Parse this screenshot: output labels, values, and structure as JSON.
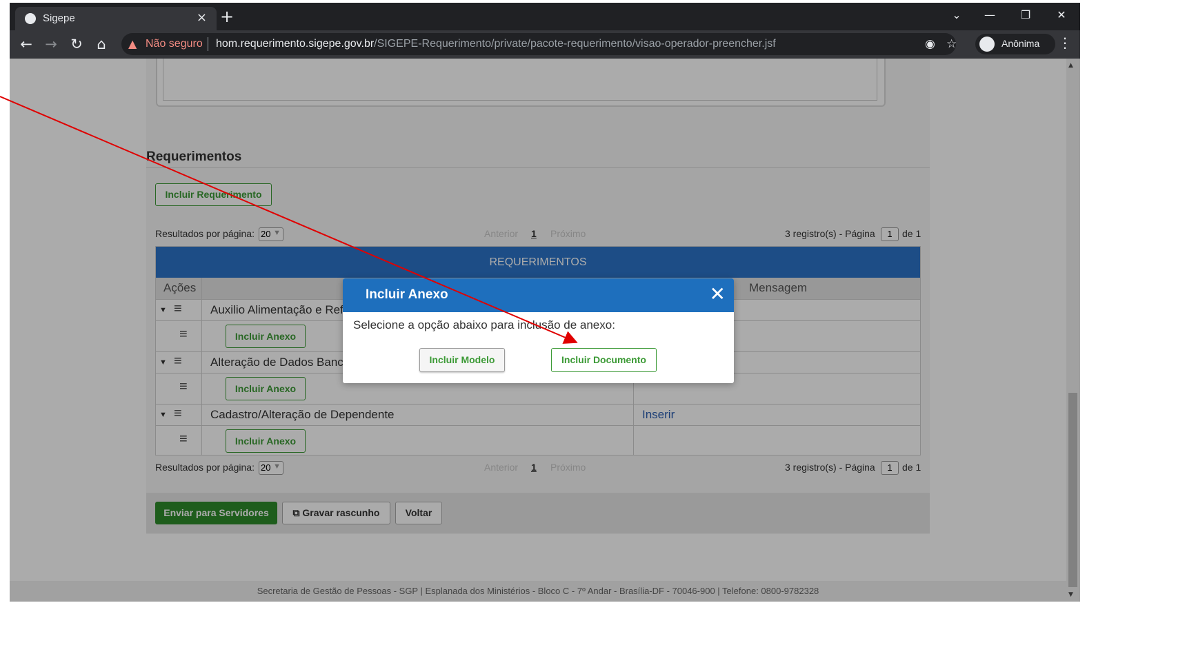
{
  "browser": {
    "tab_title": "Sigepe",
    "tab_close": "×",
    "new_tab": "+",
    "not_secure": "Não seguro",
    "url_host": "hom.requerimento.sigepe.gov.br",
    "url_path": "/SIGEPE-Requerimento/private/pacote-requerimento/visao-operador-preencher.jsf",
    "profile": "Anônima"
  },
  "section": {
    "title": "Requerimentos",
    "add_button": "Incluir Requerimento"
  },
  "pager": {
    "results_label": "Resultados por página:",
    "per_page": "20",
    "prev": "Anterior",
    "current": "1",
    "next": "Próximo",
    "records": "3 registro(s) - Página",
    "page_input": "1",
    "of_total": "de 1"
  },
  "table": {
    "title": "REQUERIMENTOS",
    "col_actions": "Ações",
    "col_message": "Mensagem",
    "rows": [
      {
        "name": "Auxilio Alimentação e Refeição",
        "message": "",
        "attach": "Incluir Anexo"
      },
      {
        "name": "Alteração de Dados Bancários",
        "message": "",
        "attach": "Incluir Anexo"
      },
      {
        "name": "Cadastro/Alteração de Dependente",
        "message": "Inserir",
        "attach": "Incluir Anexo"
      }
    ]
  },
  "footer_actions": {
    "send": "Enviar para Servidores",
    "save_draft": "Gravar rascunho",
    "back": "Voltar"
  },
  "footer_text": "Secretaria de Gestão de Pessoas - SGP | Esplanada dos Ministérios - Bloco C - 7º Andar - Brasília-DF - 70046-900 | Telefone: 0800-9782328",
  "dialog": {
    "title": "Incluir Anexo",
    "close": "✕",
    "message": "Selecione a opção abaixo para inclusão de anexo:",
    "btn_model": "Incluir Modelo",
    "btn_document": "Incluir Documento"
  },
  "colors": {
    "accent_green": "#3c9a36",
    "header_blue": "#2c74c8",
    "dialog_blue": "#1e6fbd",
    "annotation_red": "#e00000"
  }
}
